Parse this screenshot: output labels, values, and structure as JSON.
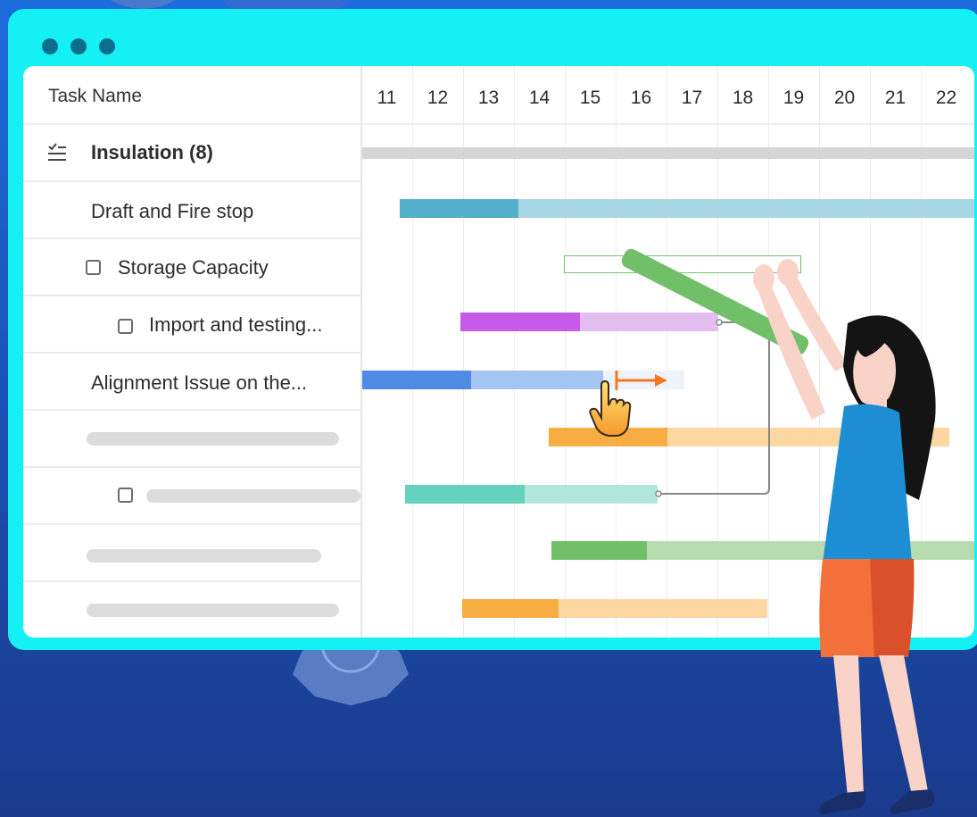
{
  "window": {
    "dots": [
      "dot",
      "dot",
      "dot"
    ]
  },
  "task_header": {
    "label": "Task Name"
  },
  "days": [
    "11",
    "12",
    "13",
    "14",
    "15",
    "16",
    "17",
    "18",
    "19",
    "20",
    "21",
    "22"
  ],
  "tasks": [
    {
      "label": "Insulation (8)",
      "icon": "checklist-icon"
    },
    {
      "label": "Draft and Fire stop"
    },
    {
      "label": "Storage Capacity"
    },
    {
      "label": "Import and testing..."
    },
    {
      "label": "Alignment Issue on the..."
    }
  ],
  "colors": {
    "background": "#1a4fb0",
    "window_frame": "#14f0f4",
    "summary_bar": "#d6d6d6",
    "teal_bar": "#52aec9",
    "purple_bar": "#c75ae8",
    "blue_bar": "#4f8ae6",
    "orange_bar": "#f7ad42",
    "green_teal_bar": "#64d2bd",
    "green_bar": "#72bf6a",
    "drag_arrow": "#f5781f"
  }
}
